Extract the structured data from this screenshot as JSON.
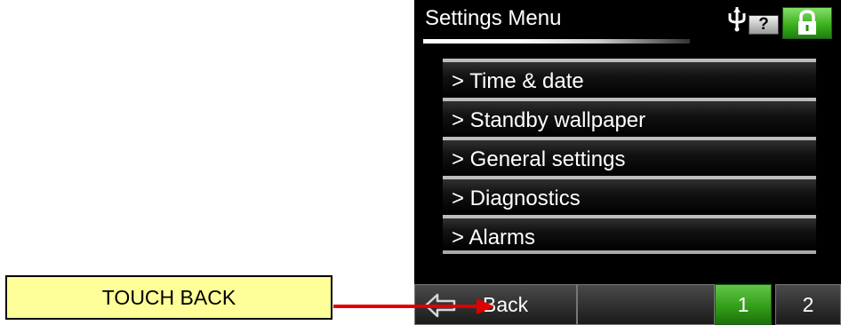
{
  "callout": {
    "label": "TOUCH BACK",
    "color": "#ffff99"
  },
  "arrow": {
    "color": "#e00000"
  },
  "header": {
    "title": "Settings Menu",
    "usb_icon": "usb-icon",
    "help_label": "?",
    "lock_icon": "lock-icon",
    "lock_color": "#3bb11c"
  },
  "menu": {
    "items": [
      {
        "label": "> Time & date"
      },
      {
        "label": "> Standby wallpaper"
      },
      {
        "label": "> General settings"
      },
      {
        "label": "> Diagnostics"
      },
      {
        "label": "> Alarms"
      }
    ]
  },
  "footer": {
    "back_label": "Back",
    "back_icon": "back-arrow-icon",
    "page_1": "1",
    "page_2": "2",
    "active_page_color": "#2f9a16"
  }
}
